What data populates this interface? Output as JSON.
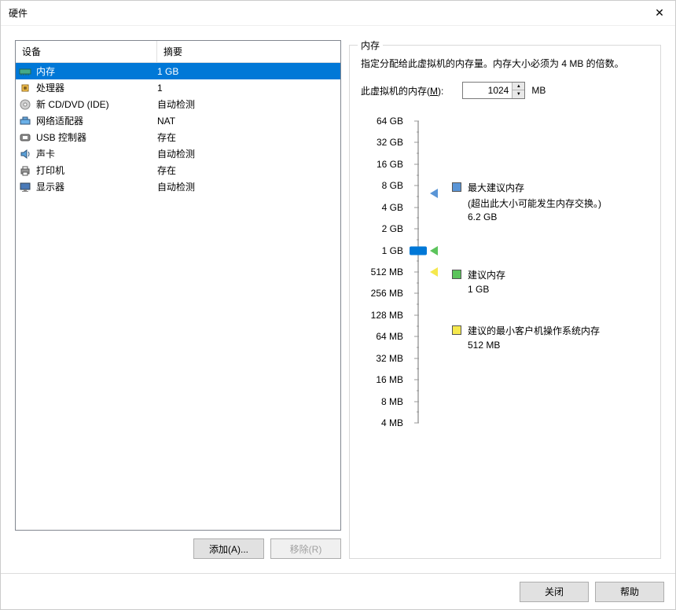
{
  "window": {
    "title": "硬件"
  },
  "deviceList": {
    "headers": {
      "device": "设备",
      "summary": "摘要"
    },
    "rows": [
      {
        "icon": "memory-icon",
        "name": "内存",
        "summary": "1 GB",
        "selected": true
      },
      {
        "icon": "cpu-icon",
        "name": "处理器",
        "summary": "1",
        "selected": false
      },
      {
        "icon": "cd-icon",
        "name": "新 CD/DVD (IDE)",
        "summary": "自动检测",
        "selected": false
      },
      {
        "icon": "network-icon",
        "name": "网络适配器",
        "summary": "NAT",
        "selected": false
      },
      {
        "icon": "usb-icon",
        "name": "USB 控制器",
        "summary": "存在",
        "selected": false
      },
      {
        "icon": "sound-icon",
        "name": "声卡",
        "summary": "自动检测",
        "selected": false
      },
      {
        "icon": "printer-icon",
        "name": "打印机",
        "summary": "存在",
        "selected": false
      },
      {
        "icon": "display-icon",
        "name": "显示器",
        "summary": "自动检测",
        "selected": false
      }
    ]
  },
  "buttons": {
    "add": "添加(A)...",
    "remove": "移除(R)",
    "close": "关闭",
    "help": "帮助"
  },
  "memoryPanel": {
    "title": "内存",
    "description": "指定分配给此虚拟机的内存量。内存大小必须为 4 MB 的倍数。",
    "inputLabelPre": "此虚拟机的内存(",
    "inputLabelKey": "M",
    "inputLabelPost": "):",
    "value": "1024",
    "unit": "MB",
    "ticks": [
      "64 GB",
      "32 GB",
      "16 GB",
      "8 GB",
      "4 GB",
      "2 GB",
      "1 GB",
      "512 MB",
      "256 MB",
      "128 MB",
      "64 MB",
      "32 MB",
      "16 MB",
      "8 MB",
      "4 MB"
    ],
    "legend": {
      "max": {
        "title": "最大建议内存",
        "sub1": "(超出此大小可能发生内存交换。)",
        "value": "6.2 GB",
        "color": "#5a95d6"
      },
      "rec": {
        "title": "建议内存",
        "value": "1 GB",
        "color": "#5cc45c"
      },
      "min": {
        "title": "建议的最小客户机操作系统内存",
        "value": "512 MB",
        "color": "#f5e84d"
      }
    }
  }
}
